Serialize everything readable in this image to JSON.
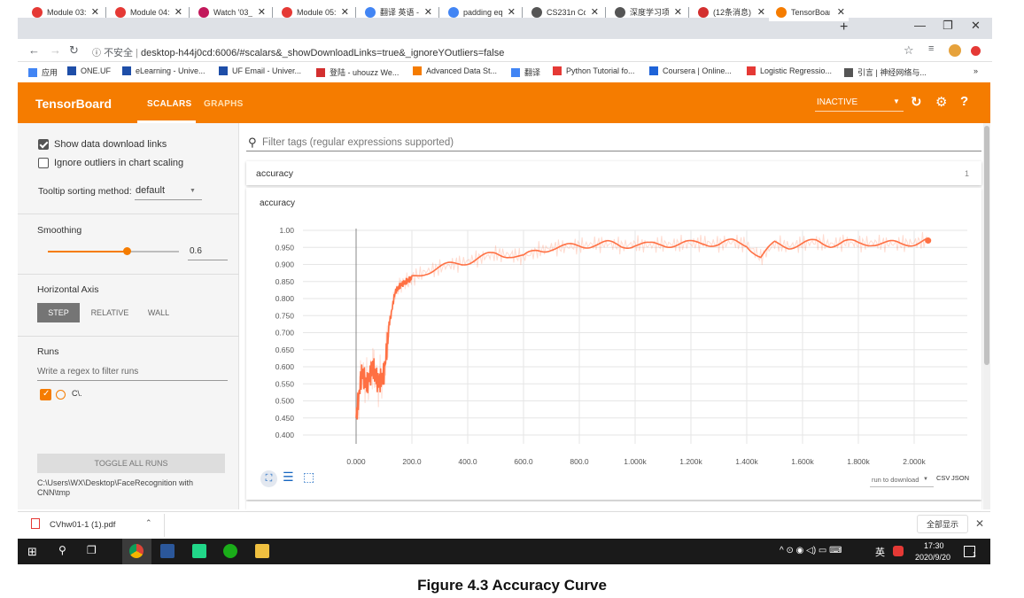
{
  "browser": {
    "tabs": [
      {
        "label": "Module 03:",
        "color": "#e53935"
      },
      {
        "label": "Module 04:",
        "color": "#e53935"
      },
      {
        "label": "Watch '03_",
        "color": "#c2185b"
      },
      {
        "label": "Module 05:",
        "color": "#e53935"
      },
      {
        "label": "翻译 英语 -",
        "color": "#4285f4"
      },
      {
        "label": "padding eq",
        "color": "#4285f4"
      },
      {
        "label": "CS231n Co",
        "color": "#555555"
      },
      {
        "label": "深度学习项目",
        "color": "#555555"
      },
      {
        "label": "(12条消息)",
        "color": "#d32f2f"
      },
      {
        "label": "TensorBoar",
        "color": "#f57c00"
      }
    ],
    "new_tab": "+",
    "window_controls": {
      "minimize": "—",
      "restore": "❐",
      "close": "✕"
    },
    "insecure_label": "不安全",
    "url": "desktop-h44j0cd:6006/#scalars&_showDownloadLinks=true&_ignoreYOutliers=false",
    "bookmarks": [
      {
        "label": "应用",
        "color": "#4285f4"
      },
      {
        "label": "ONE.UF",
        "color": "#1e4ea8"
      },
      {
        "label": "eLearning - Unive...",
        "color": "#1e4ea8"
      },
      {
        "label": "UF Email - Univer...",
        "color": "#1e4ea8"
      },
      {
        "label": "登陆 - uhouzz We...",
        "color": "#d32f2f"
      },
      {
        "label": "Advanced Data St...",
        "color": "#f57c00"
      },
      {
        "label": "翻译",
        "color": "#4285f4"
      },
      {
        "label": "Python Tutorial fo...",
        "color": "#e53935"
      },
      {
        "label": "Coursera | Online...",
        "color": "#1e63d8"
      },
      {
        "label": "Logistic Regressio...",
        "color": "#e53935"
      },
      {
        "label": "引言 | 神经网络与...",
        "color": "#555555"
      }
    ],
    "bookmarks_more": "»"
  },
  "tensorboard": {
    "title": "TensorBoard",
    "tabs": [
      "SCALARS",
      "GRAPHS"
    ],
    "status": "INACTIVE",
    "accent": "#f57c00"
  },
  "sidebar": {
    "show_download_links": "Show data download links",
    "ignore_outliers": "Ignore outliers in chart scaling",
    "tooltip_label": "Tooltip sorting method:",
    "tooltip_value": "default",
    "smoothing_label": "Smoothing",
    "smoothing_value": "0.6",
    "smoothing_fraction": 0.6,
    "horizontal_axis_label": "Horizontal Axis",
    "axis_options": [
      "STEP",
      "RELATIVE",
      "WALL"
    ],
    "runs_label": "Runs",
    "runs_filter_placeholder": "Write a regex to filter runs",
    "run_name": "C\\.",
    "toggle_all": "TOGGLE ALL RUNS",
    "log_dir": "C:\\Users\\WX\\Desktop\\FaceRecognition with CNN\\tmp"
  },
  "main": {
    "filter_placeholder": "Filter tags (regular expressions supported)",
    "card_title": "accuracy",
    "card_count": "1",
    "chart_title": "accuracy",
    "run_to_download": "run to download",
    "csv": "CSV",
    "json": "JSON"
  },
  "chart_data": {
    "type": "line",
    "title": "accuracy",
    "xlabel": "",
    "ylabel": "",
    "x_ticks": [
      "0.000",
      "200.0",
      "400.0",
      "600.0",
      "800.0",
      "1.000k",
      "1.200k",
      "1.400k",
      "1.600k",
      "1.800k",
      "2.000k"
    ],
    "y_ticks": [
      "1.00",
      "0.950",
      "0.900",
      "0.850",
      "0.800",
      "0.750",
      "0.700",
      "0.650",
      "0.600",
      "0.550",
      "0.500",
      "0.450",
      "0.400"
    ],
    "xlim": [
      0,
      2000
    ],
    "ylim": [
      0.4,
      1.0
    ],
    "grid": true,
    "series": [
      {
        "color": "#ff7043",
        "x": [
          0,
          20,
          40,
          60,
          80,
          100,
          120,
          140,
          160,
          180,
          200,
          250,
          300,
          350,
          400,
          450,
          500,
          550,
          600,
          650,
          700,
          750,
          800,
          850,
          900,
          950,
          1000,
          1050,
          1100,
          1150,
          1200,
          1250,
          1300,
          1350,
          1400,
          1450,
          1500,
          1550,
          1600,
          1650,
          1700,
          1750,
          1800,
          1850,
          1900,
          1950,
          2000,
          2050
        ],
        "values": [
          0.45,
          0.58,
          0.55,
          0.6,
          0.55,
          0.58,
          0.73,
          0.82,
          0.84,
          0.85,
          0.86,
          0.88,
          0.89,
          0.9,
          0.91,
          0.92,
          0.93,
          0.93,
          0.92,
          0.94,
          0.95,
          0.95,
          0.955,
          0.96,
          0.96,
          0.955,
          0.96,
          0.955,
          0.96,
          0.96,
          0.96,
          0.965,
          0.96,
          0.965,
          0.96,
          0.92,
          0.96,
          0.955,
          0.96,
          0.965,
          0.96,
          0.965,
          0.96,
          0.965,
          0.96,
          0.96,
          0.965,
          0.97
        ]
      }
    ]
  },
  "download": {
    "file": "CVhw01-1 (1).pdf",
    "show_all": "全部显示"
  },
  "taskbar": {
    "time": "17:30",
    "date": "2020/9/20",
    "ime": "英",
    "notif": "1"
  },
  "caption": "Figure 4.3 Accuracy Curve"
}
